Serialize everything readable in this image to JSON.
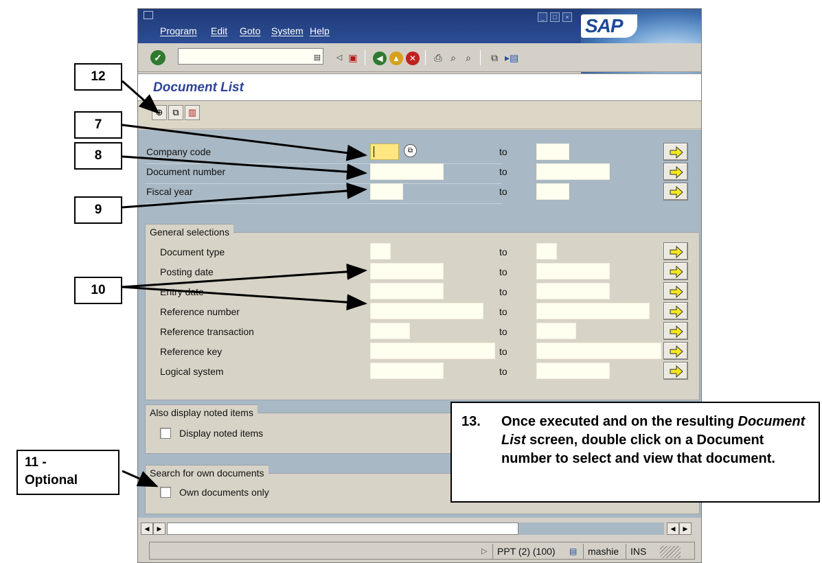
{
  "menu": [
    "Program",
    "Edit",
    "Goto",
    "System",
    "Help"
  ],
  "logo_text": "SAP",
  "page_title": "Document List",
  "main_fields": [
    {
      "label": "Company code",
      "to": "to"
    },
    {
      "label": "Document number",
      "to": "to"
    },
    {
      "label": "Fiscal year",
      "to": "to"
    }
  ],
  "general": {
    "tab": "General selections",
    "fields": [
      {
        "label": "Document type",
        "to": "to"
      },
      {
        "label": "Posting date",
        "to": "to"
      },
      {
        "label": "Entry date",
        "to": "to"
      },
      {
        "label": "Reference number",
        "to": "to"
      },
      {
        "label": "Reference transaction",
        "to": "to"
      },
      {
        "label": "Reference key",
        "to": "to"
      },
      {
        "label": "Logical system",
        "to": "to"
      }
    ]
  },
  "noted": {
    "tab": "Also display noted items",
    "checkbox": "Display noted items"
  },
  "own": {
    "tab": "Search for own documents",
    "checkbox": "Own documents only"
  },
  "status": {
    "system": "PPT (2) (100)",
    "user": "mashie",
    "mode": "INS"
  },
  "annotations": {
    "a12": "12",
    "a7": "7",
    "a8": "8",
    "a9": "9",
    "a10": "10",
    "a11_line1": "11 -",
    "a11_line2": "Optional",
    "note_num": "13.",
    "note_pre": "Once executed and on the resulting ",
    "note_italic": "Document List",
    "note_post": " screen, double click on a Document number to select and view that document."
  },
  "colors": {
    "field_bg": "#fffff0",
    "active_field": "#ffe680",
    "title_color": "#2c4496",
    "frame_bg": "#a8b8c4"
  }
}
